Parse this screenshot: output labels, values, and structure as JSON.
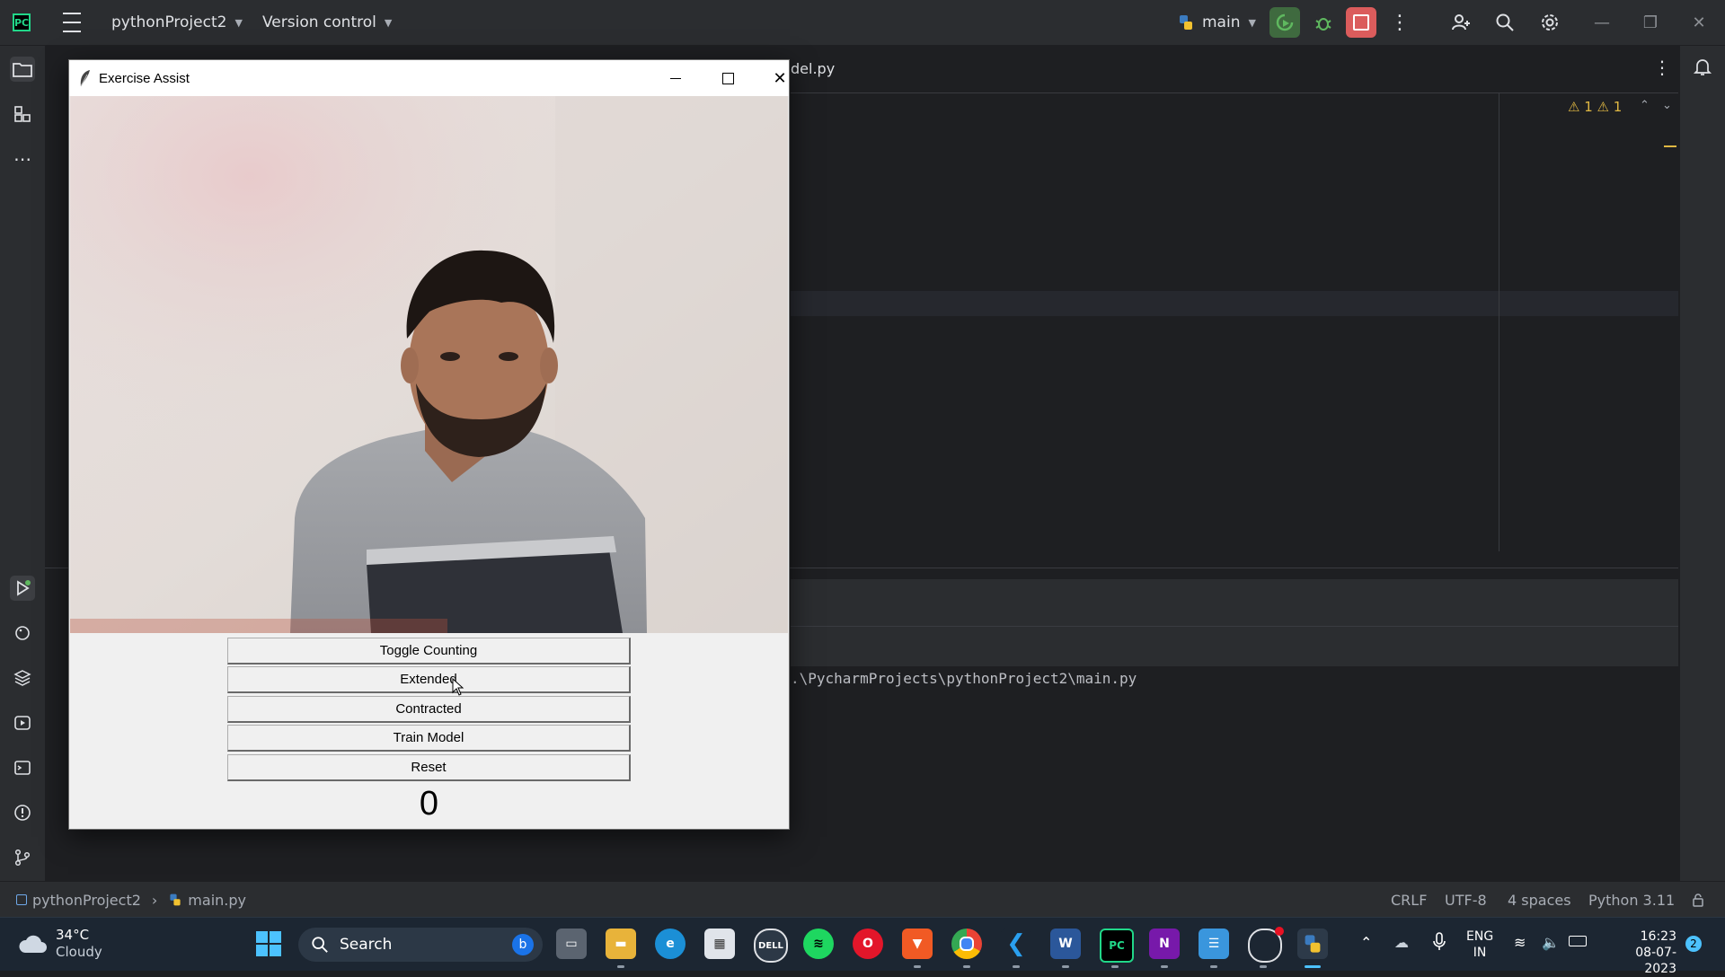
{
  "ide": {
    "project_name": "pythonProject2",
    "version_control": "Version control",
    "run_config": "main",
    "editor_tab_fragment": "del.py",
    "warnings": "⚠ 1 ⚠ 1",
    "console_path": ".\\PycharmProjects\\pythonProject2\\main.py"
  },
  "statusbar": {
    "breadcrumb_project": "pythonProject2",
    "breadcrumb_file": "main.py",
    "line_ending": "CRLF",
    "encoding": "UTF-8",
    "indent": "4 spaces",
    "interpreter": "Python 3.11"
  },
  "app_window": {
    "title": "Exercise Assist",
    "buttons": {
      "toggle": "Toggle Counting",
      "extended": "Extended",
      "contracted": "Contracted",
      "train": "Train Model",
      "reset": "Reset"
    },
    "counter": "0"
  },
  "taskbar": {
    "temperature": "34°C",
    "weather": "Cloudy",
    "search_label": "Search",
    "lang_line1": "ENG",
    "lang_line2": "IN",
    "time": "16:23",
    "date": "08-07-2023",
    "notification_count": "2"
  },
  "colors": {
    "ide_background": "#1e1f22",
    "ide_panel": "#2b2d30",
    "run_button": "#4e9a4e",
    "stop_button": "#db5c5c",
    "taskbar": "#1c2632"
  }
}
